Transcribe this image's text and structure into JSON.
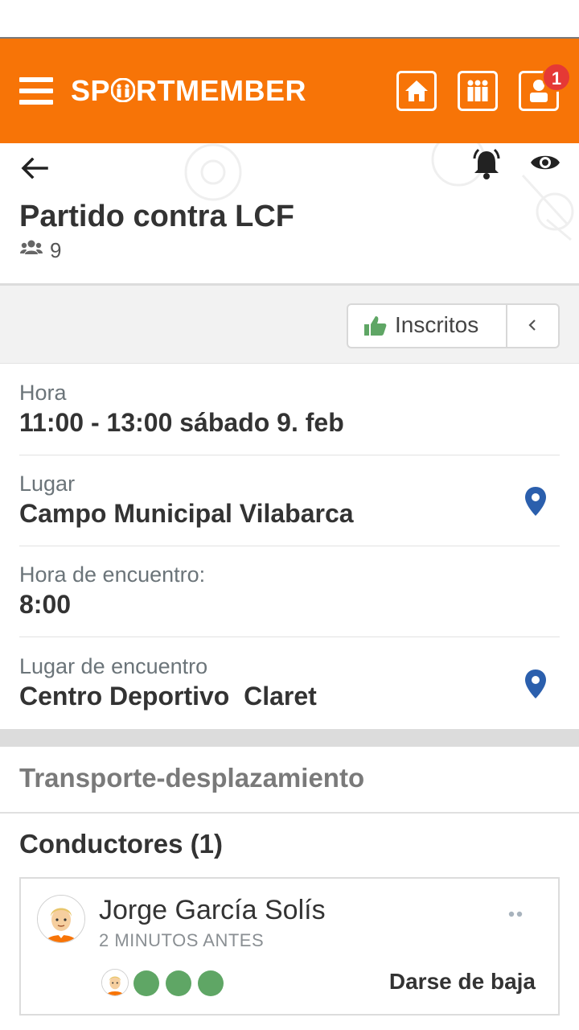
{
  "app": {
    "logo_text_before": "SP",
    "logo_text_after": "RTMEMBER",
    "notification_count": "1",
    "accent_color": "#f77407"
  },
  "event": {
    "title": "Partido contra LCF",
    "participants": "9"
  },
  "toolbar": {
    "inscritos_label": "Inscritos"
  },
  "details": [
    {
      "label": "Hora",
      "value": "11:00 - 13:00 sábado 9. feb"
    },
    {
      "label": "Lugar",
      "value": "Campo Municipal Vilabarca"
    },
    {
      "label": "Hora de encuentro:",
      "value": "8:00"
    },
    {
      "label": "Lugar de encuentro",
      "value": "Centro Deportivo  Claret"
    }
  ],
  "transport": {
    "section_title": "Transporte-desplazamiento",
    "drivers_title": "Conductores (1)",
    "drivers": [
      {
        "name": "Jorge García Solís",
        "time": "2 MINUTOS ANTES",
        "free_seats": 3,
        "action_label": "Darse de baja"
      }
    ]
  },
  "icons": {
    "menu": "hamburger-icon",
    "home": "home-icon",
    "team": "team-icon",
    "profile": "profile-icon",
    "back": "arrow-left-icon",
    "bell": "bell-icon",
    "eye": "eye-icon",
    "group": "group-icon",
    "thumb": "thumbs-up-icon",
    "collapse": "chevron-left-icon",
    "pin": "map-pin-icon",
    "more": "more-dots-icon"
  },
  "colors": {
    "seat_free": "#5fa665",
    "pin": "#2b5fad"
  }
}
